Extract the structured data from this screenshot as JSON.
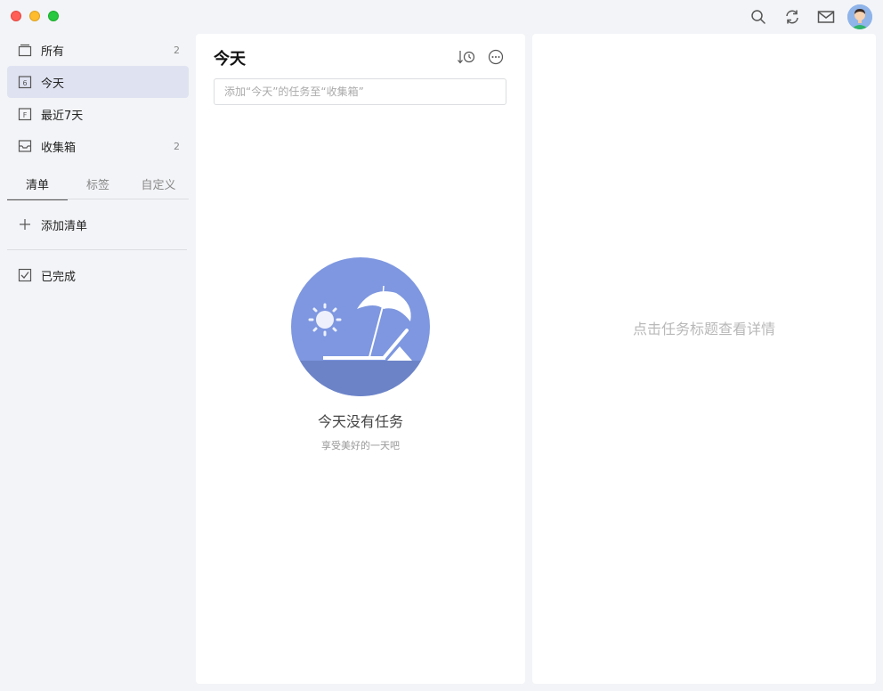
{
  "sidebar": {
    "items": [
      {
        "label": "所有",
        "count": "2",
        "icon": "stack-icon"
      },
      {
        "label": "今天",
        "count": "",
        "icon": "calendar-today-icon",
        "badge": "6"
      },
      {
        "label": "最近7天",
        "count": "",
        "icon": "calendar-week-icon",
        "badge": "F"
      },
      {
        "label": "收集箱",
        "count": "2",
        "icon": "inbox-icon"
      }
    ],
    "tabs": [
      "清单",
      "标签",
      "自定义"
    ],
    "add_list_label": "添加清单",
    "completed_label": "已完成"
  },
  "middle": {
    "title": "今天",
    "input_placeholder": "添加“今天”的任务至“收集箱”",
    "empty_title": "今天没有任务",
    "empty_subtitle": "享受美好的一天吧"
  },
  "right": {
    "hint": "点击任务标题查看详情"
  },
  "colors": {
    "accent": "#7e97e0",
    "active_bg": "#dfe3f1"
  }
}
